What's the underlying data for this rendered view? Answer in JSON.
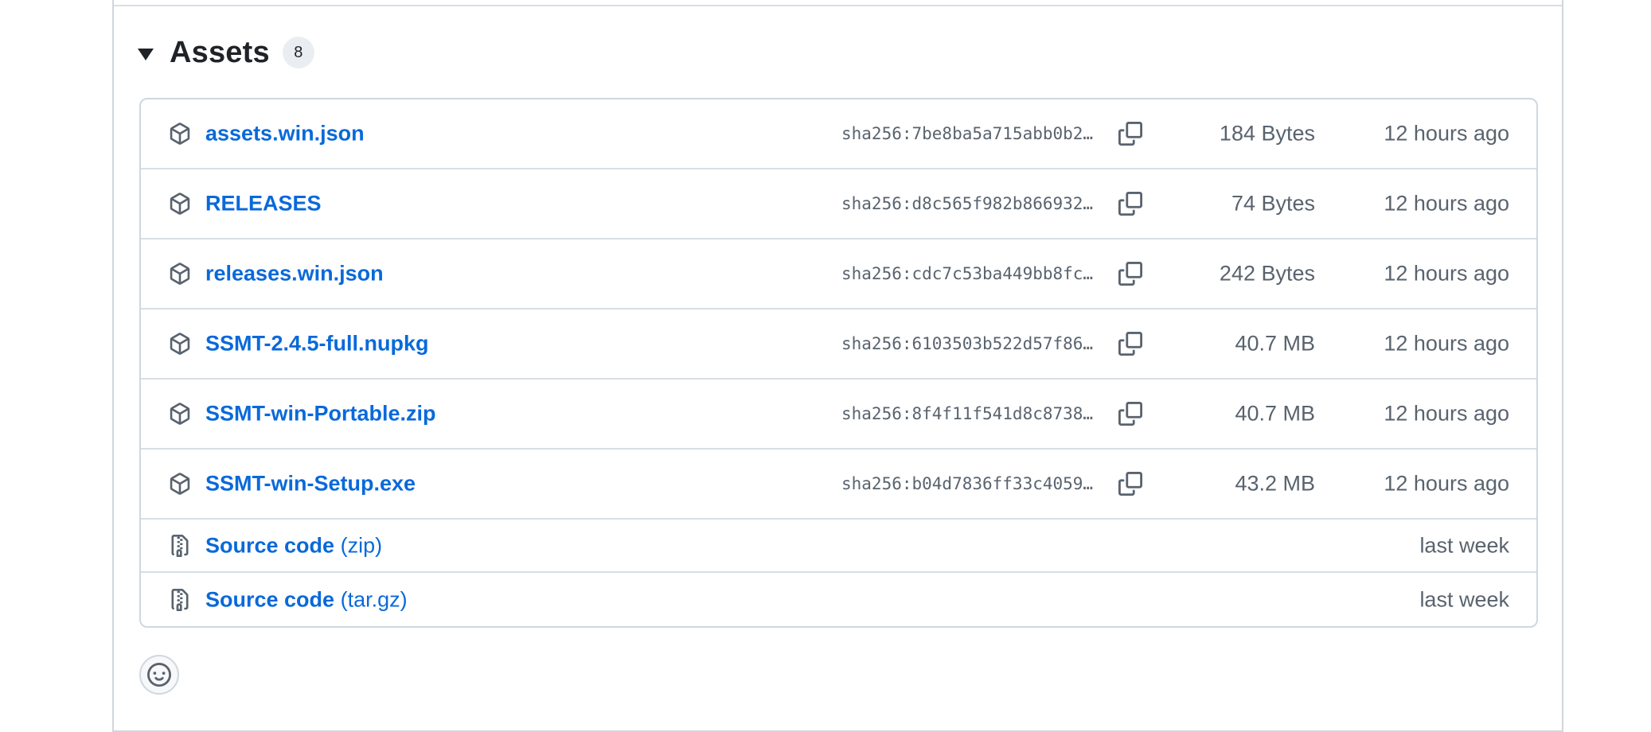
{
  "assets": {
    "title": "Assets",
    "count": "8",
    "files": [
      {
        "name": "assets.win.json",
        "sha": "sha256:7be8ba5a715abb0b2…",
        "size": "184 Bytes",
        "time": "12 hours ago"
      },
      {
        "name": "RELEASES",
        "sha": "sha256:d8c565f982b866932…",
        "size": "74 Bytes",
        "time": "12 hours ago"
      },
      {
        "name": "releases.win.json",
        "sha": "sha256:cdc7c53ba449bb8fc…",
        "size": "242 Bytes",
        "time": "12 hours ago"
      },
      {
        "name": "SSMT-2.4.5-full.nupkg",
        "sha": "sha256:6103503b522d57f86…",
        "size": "40.7 MB",
        "time": "12 hours ago"
      },
      {
        "name": "SSMT-win-Portable.zip",
        "sha": "sha256:8f4f11f541d8c8738…",
        "size": "40.7 MB",
        "time": "12 hours ago"
      },
      {
        "name": "SSMT-win-Setup.exe",
        "sha": "sha256:b04d7836ff33c4059…",
        "size": "43.2 MB",
        "time": "12 hours ago"
      }
    ],
    "source": [
      {
        "label": "Source code",
        "ext": "(zip)",
        "time": "last week"
      },
      {
        "label": "Source code",
        "ext": "(tar.gz)",
        "time": "last week"
      }
    ]
  },
  "icons": {
    "caret": "triangle-down-icon",
    "file": "package-icon",
    "source": "file-zip-icon",
    "copy": "copy-icon",
    "reaction": "smiley-icon"
  },
  "colors": {
    "link": "#0969da",
    "muted": "#59636e",
    "border": "#d0d7de"
  }
}
